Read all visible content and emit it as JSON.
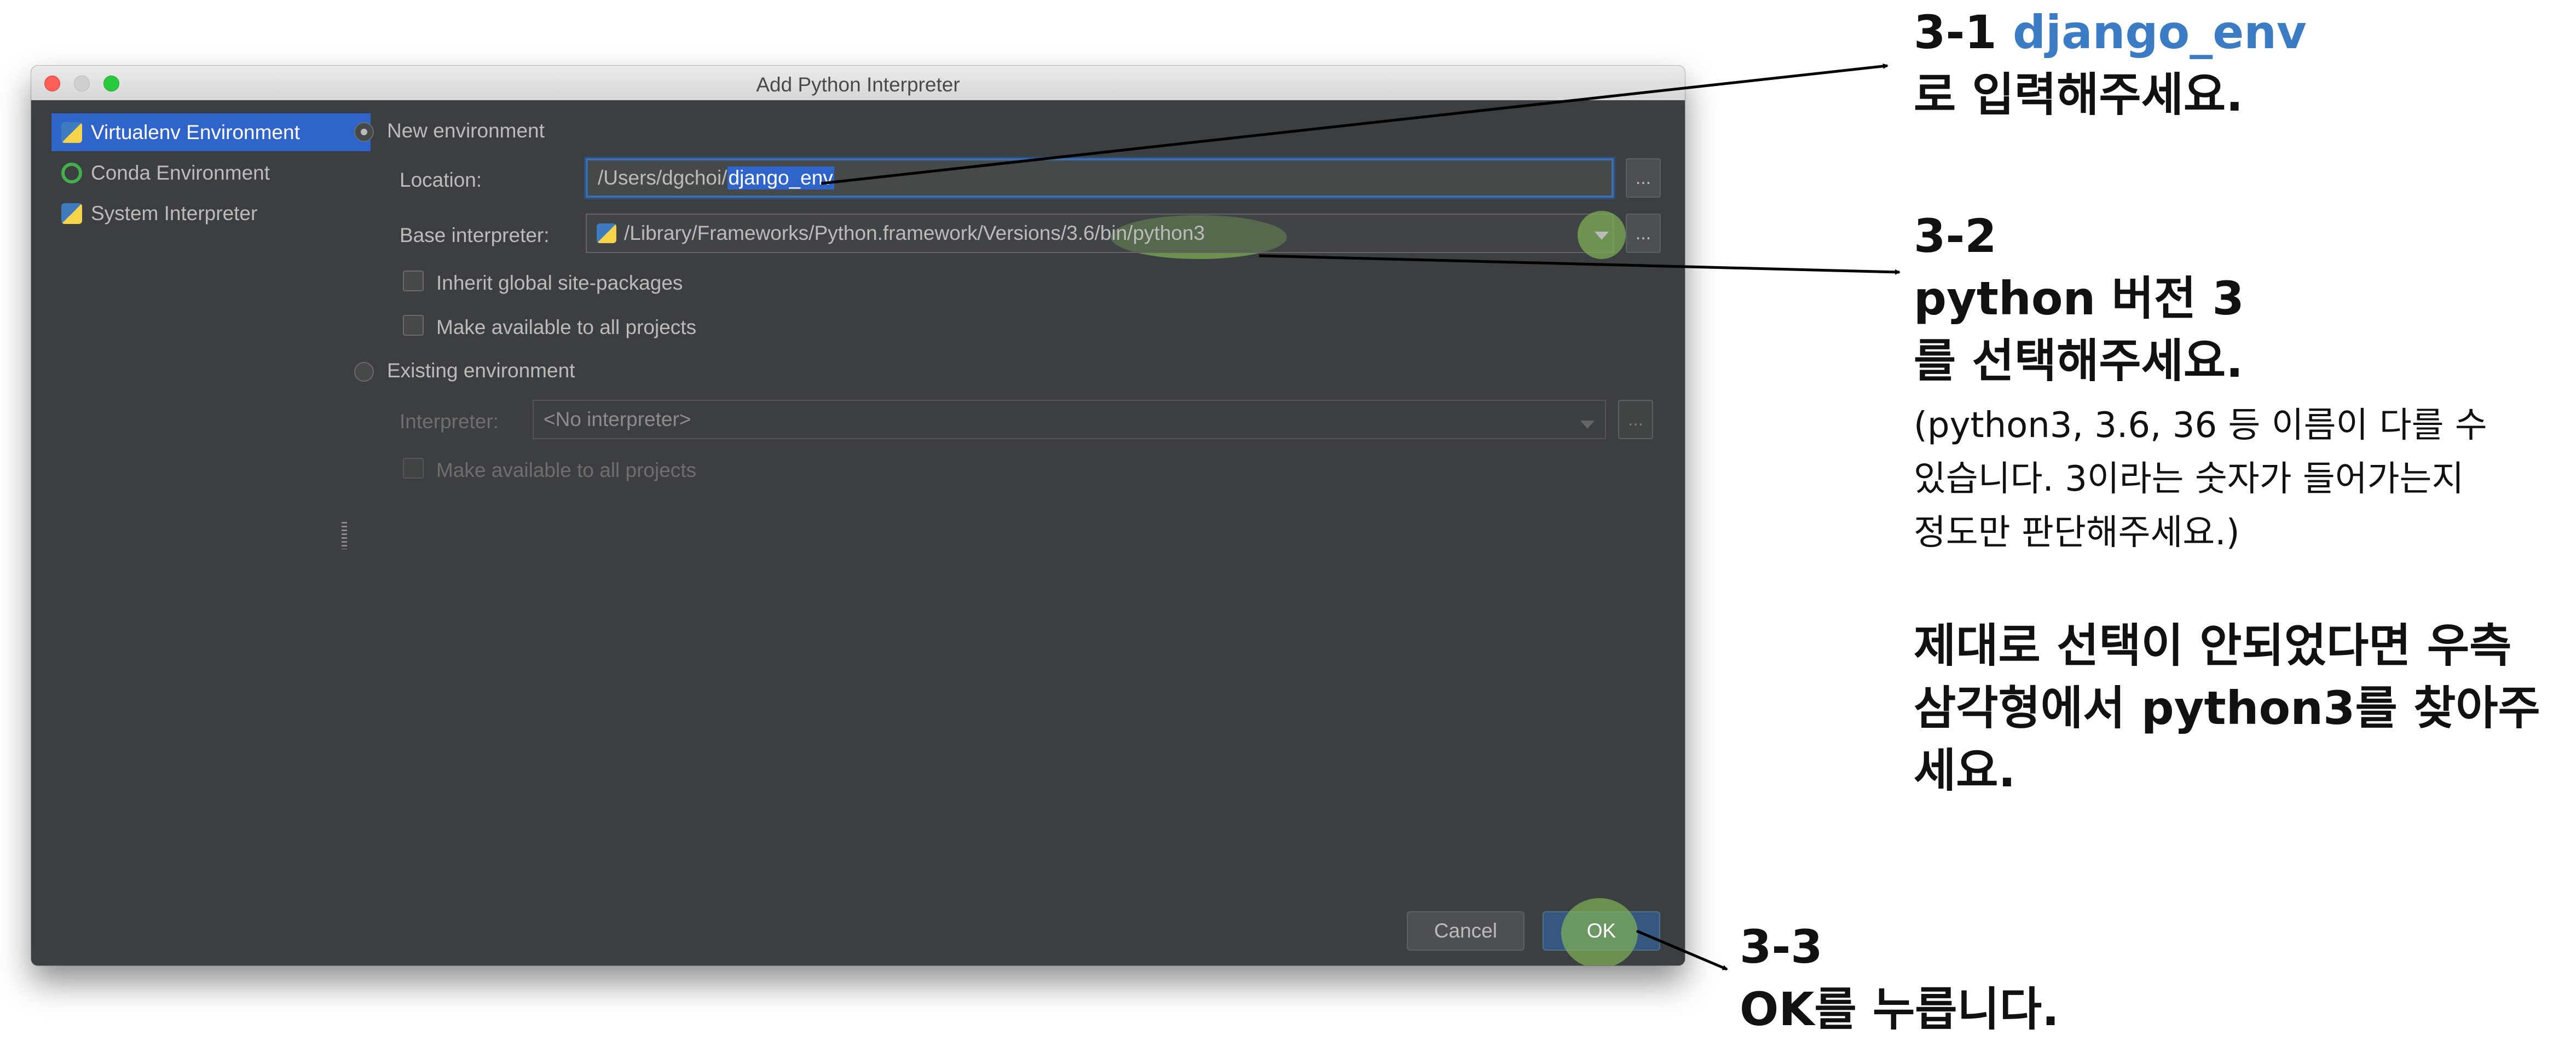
{
  "window": {
    "title": "Add Python Interpreter"
  },
  "sidebar": {
    "items": [
      {
        "label": "Virtualenv Environment",
        "icon": "python-icon",
        "selected": true
      },
      {
        "label": "Conda Environment",
        "icon": "conda-ring-icon",
        "selected": false
      },
      {
        "label": "System Interpreter",
        "icon": "python-icon",
        "selected": false
      }
    ]
  },
  "new_env": {
    "radio_label": "New environment",
    "location_label": "Location:",
    "location_prefix": "/Users/dgchoi/",
    "location_selected": "django_env",
    "base_label": "Base interpreter:",
    "base_prefix": "/Library/Frameworks/Python.framework/Versions/",
    "base_highlight": "3.6/bin/python3",
    "inherit_label": "Inherit global site-packages",
    "make_available_label": "Make available to all projects"
  },
  "existing_env": {
    "radio_label": "Existing environment",
    "interpreter_label": "Interpreter:",
    "interpreter_value": "<No interpreter>",
    "make_available_label": "Make available to all projects"
  },
  "buttons": {
    "browse": "...",
    "cancel": "Cancel",
    "ok": "OK"
  },
  "annotations": {
    "a1": {
      "step": "3-1 ",
      "name": "django_env",
      "line2": "로 입력해주세요."
    },
    "a2": {
      "step": "3-2",
      "line2": "python 버전 3",
      "line3": "를 선택해주세요.",
      "note1": "(python3, 3.6, 36 등 이름이 다를 수",
      "note2": "있습니다. 3이라는 숫자가 들어가는지",
      "note3": "정도만 판단해주세요.)",
      "tip1": "제대로 선택이 안되었다면 우측",
      "tip2": "삼각형에서 python3를 찾아주",
      "tip3": "세요."
    },
    "a3": {
      "step": "3-3",
      "line2": "OK를 누릅니다."
    }
  },
  "colors": {
    "accent_blue": "#3b7cc4",
    "highlight_green": "#7eb056",
    "selection": "#2f65ca"
  }
}
